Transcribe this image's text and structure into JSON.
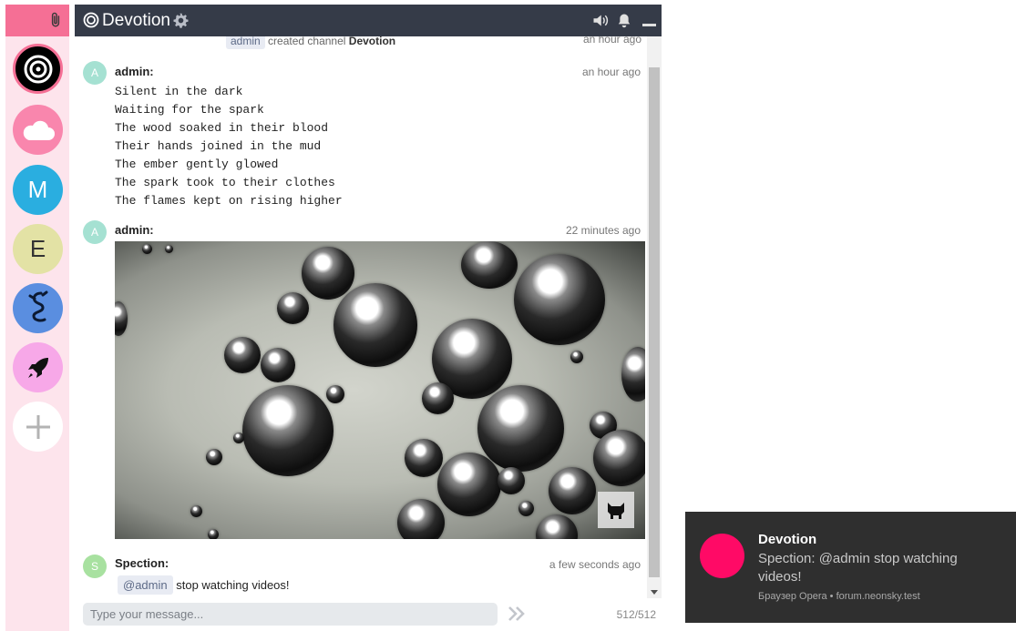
{
  "colors": {
    "rail_bg": "#fde4ec",
    "rail_accent": "#f56f95",
    "header_bg": "#353b48",
    "toast_bg": "#2f2f2f",
    "toast_dot": "#ff0a66"
  },
  "header": {
    "title": "Devotion",
    "channel_icon": "target-icon",
    "settings_icon": "gear-icon",
    "sound_icon": "volume-icon",
    "notify_icon": "bell-icon",
    "minimize_icon": "minimize-icon"
  },
  "rail": {
    "attach_icon": "paperclip-icon",
    "servers": [
      {
        "type": "icon",
        "icon": "target-icon",
        "color": "#000000",
        "active": true
      },
      {
        "type": "icon",
        "icon": "cloud-icon",
        "color": "#f986ad"
      },
      {
        "type": "letter",
        "letter": "M",
        "color": "#2aaee0"
      },
      {
        "type": "letter",
        "letter": "E",
        "color": "#e3e2a5"
      },
      {
        "type": "icon",
        "icon": "dragon-icon",
        "color": "#5a8ee0"
      },
      {
        "type": "icon",
        "icon": "rocket-icon",
        "color": "#f7a8e8"
      },
      {
        "type": "icon",
        "icon": "plus-icon",
        "color": "#ffffff"
      }
    ]
  },
  "system": {
    "user": "admin",
    "text": "created channel",
    "channel": "Devotion",
    "time": "an hour ago"
  },
  "messages": [
    {
      "avatar": "A",
      "avatar_color": "#a5e1d2",
      "author": "admin:",
      "time": "an hour ago",
      "lines": [
        "Silent in the dark",
        "Waiting for the spark",
        "The wood soaked in their blood",
        "Their hands joined in the mud",
        "The ember gently glowed",
        "The spark took to their clothes",
        "The flames kept on rising higher"
      ]
    },
    {
      "avatar": "A",
      "avatar_color": "#a5e1d2",
      "author": "admin:",
      "time": "22 minutes ago",
      "attachment": "video-embed",
      "attachment_icon": "monstercat-icon"
    },
    {
      "avatar": "S",
      "avatar_color": "#a8e1a0",
      "author": "Spection:",
      "time": "a few seconds ago",
      "mention": "@admin",
      "text": "stop watching videos!"
    }
  ],
  "composer": {
    "placeholder": "Type your message...",
    "send_icon": "double-chevron-right-icon",
    "counter": "512/512"
  },
  "toast": {
    "title": "Devotion",
    "body": "Spection: @admin stop watching videos!",
    "source": "Браузер Opera • forum.neonsky.test"
  }
}
